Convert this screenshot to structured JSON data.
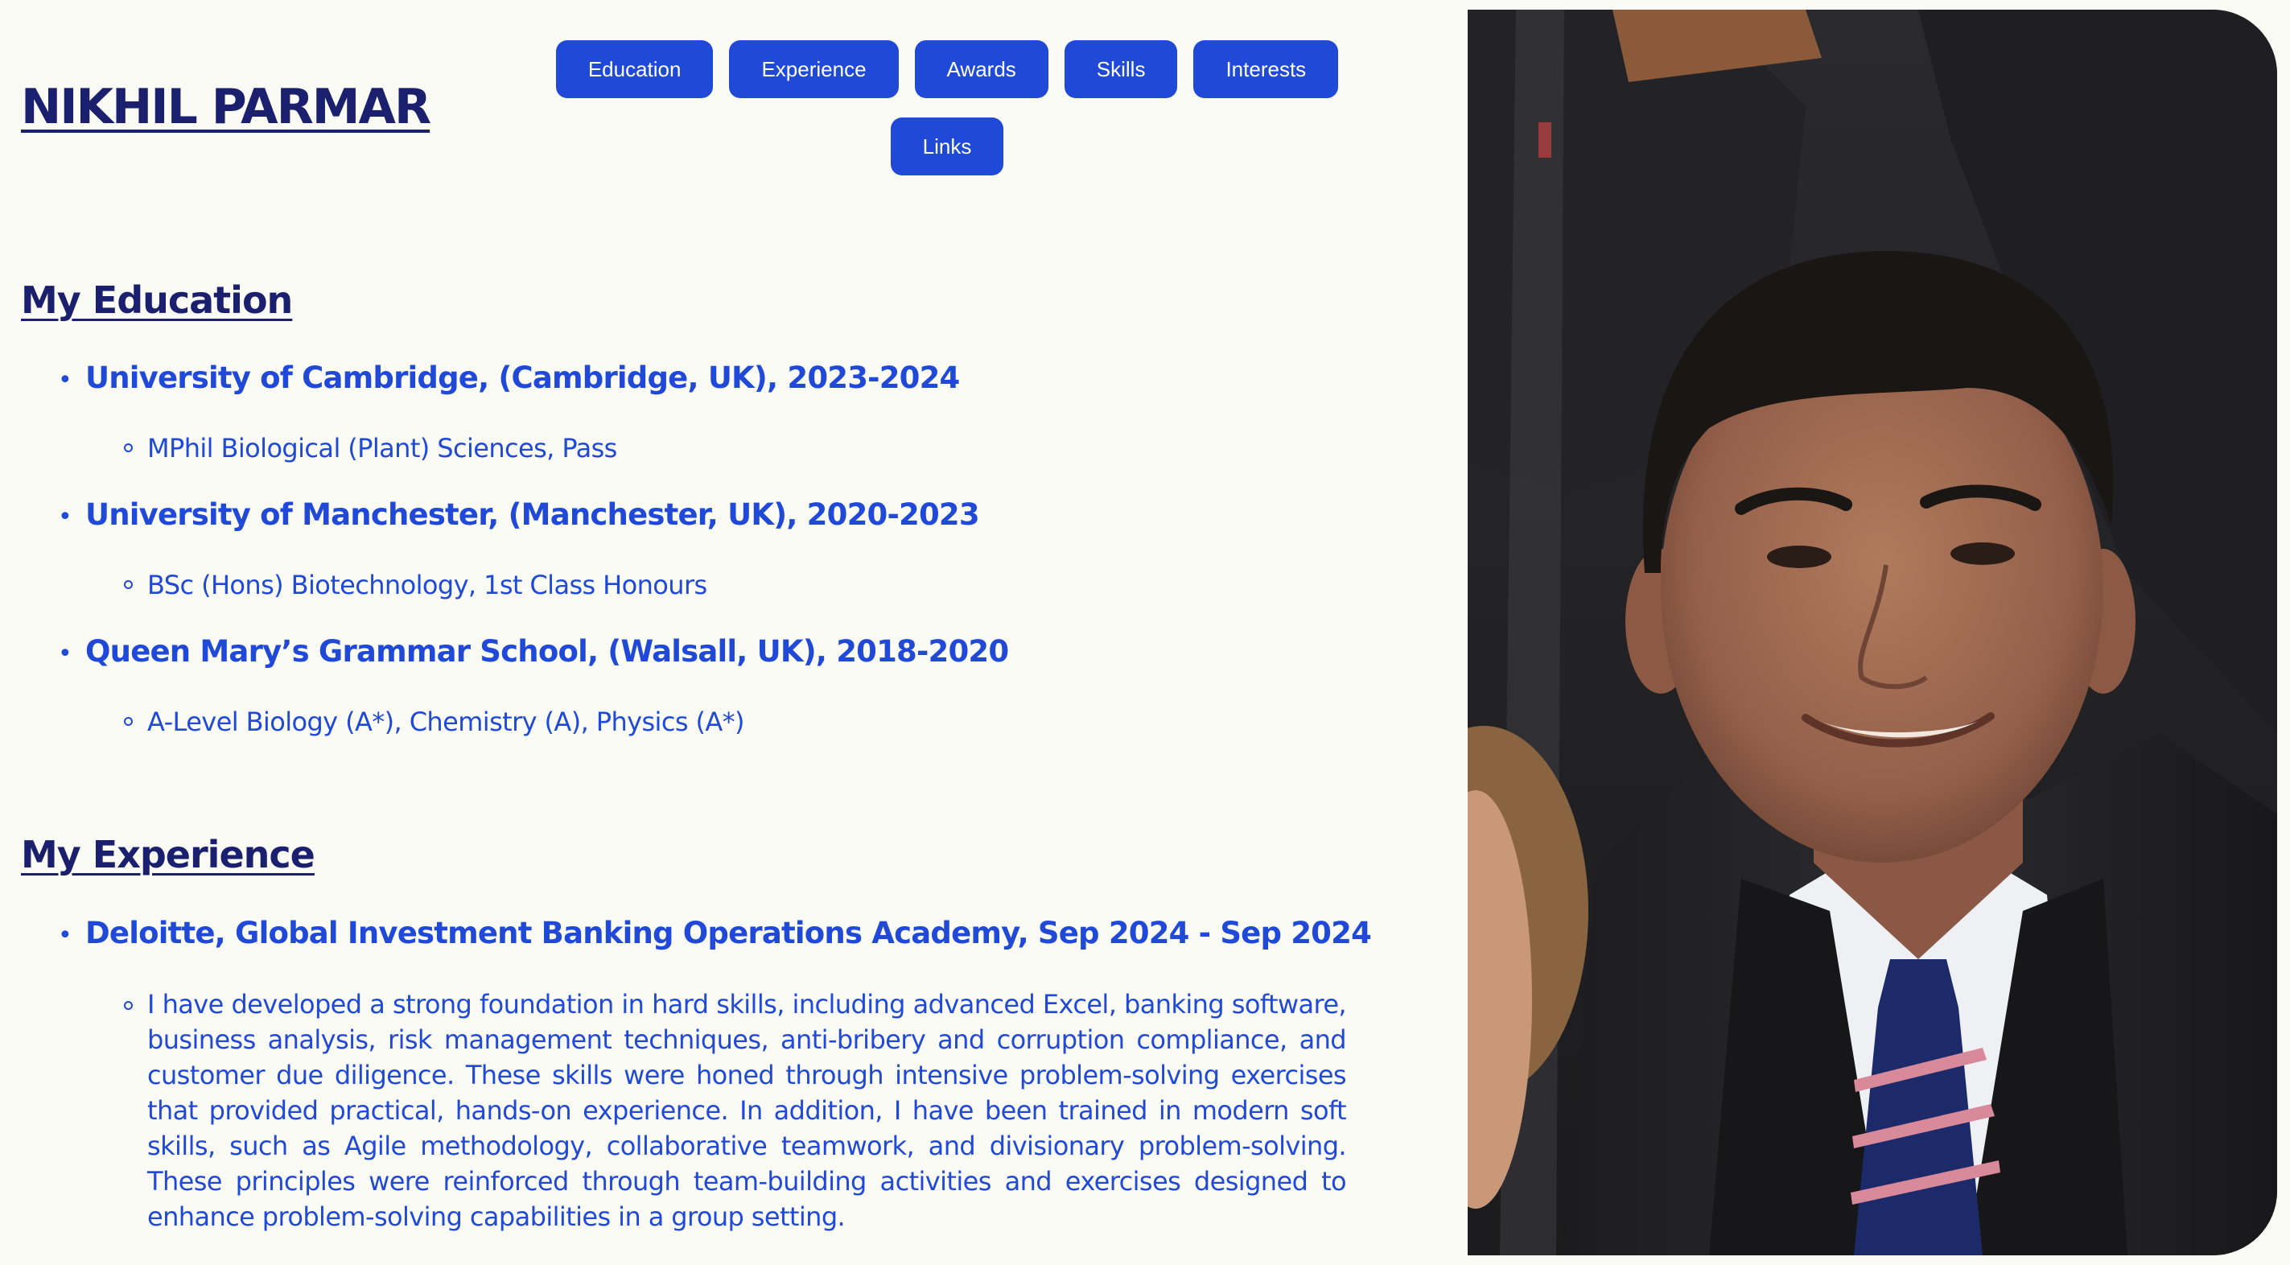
{
  "header": {
    "name": "NIKHIL PARMAR"
  },
  "nav": {
    "items": [
      {
        "label": "Education"
      },
      {
        "label": "Experience"
      },
      {
        "label": "Awards"
      },
      {
        "label": "Skills"
      },
      {
        "label": "Interests"
      },
      {
        "label": "Links"
      }
    ]
  },
  "education": {
    "title": "My Education",
    "entries": [
      {
        "title": "University of Cambridge, (Cambridge, UK), 2023-2024",
        "detail": "MPhil Biological (Plant) Sciences, Pass"
      },
      {
        "title": "University of Manchester, (Manchester, UK), 2020-2023",
        "detail": "BSc (Hons) Biotechnology, 1st Class Honours"
      },
      {
        "title": "Queen Mary’s Grammar School, (Walsall, UK), 2018-2020",
        "detail": "A-Level Biology (A*), Chemistry (A), Physics (A*)"
      }
    ]
  },
  "experience": {
    "title": "My Experience",
    "entries": [
      {
        "title": "Deloitte, Global Investment Banking Operations Academy, Sep 2024 - Sep 2024",
        "detail": "I have developed a strong foundation in hard skills, including advanced Excel, banking software, business analysis, risk management techniques, anti-bribery and corruption compliance, and customer due diligence. These skills were honed through intensive problem-solving exercises that provided practical, hands-on experience. In addition, I have been trained in modern soft skills, such as Agile methodology, collaborative teamwork, and divisionary problem-solving. These principles were reinforced through team-building activities and exercises designed to enhance problem-solving capabilities in a group setting."
      }
    ]
  },
  "colors": {
    "background": "#fbfbf5",
    "accent": "#1f49d6",
    "heading": "#1a1f6e"
  }
}
